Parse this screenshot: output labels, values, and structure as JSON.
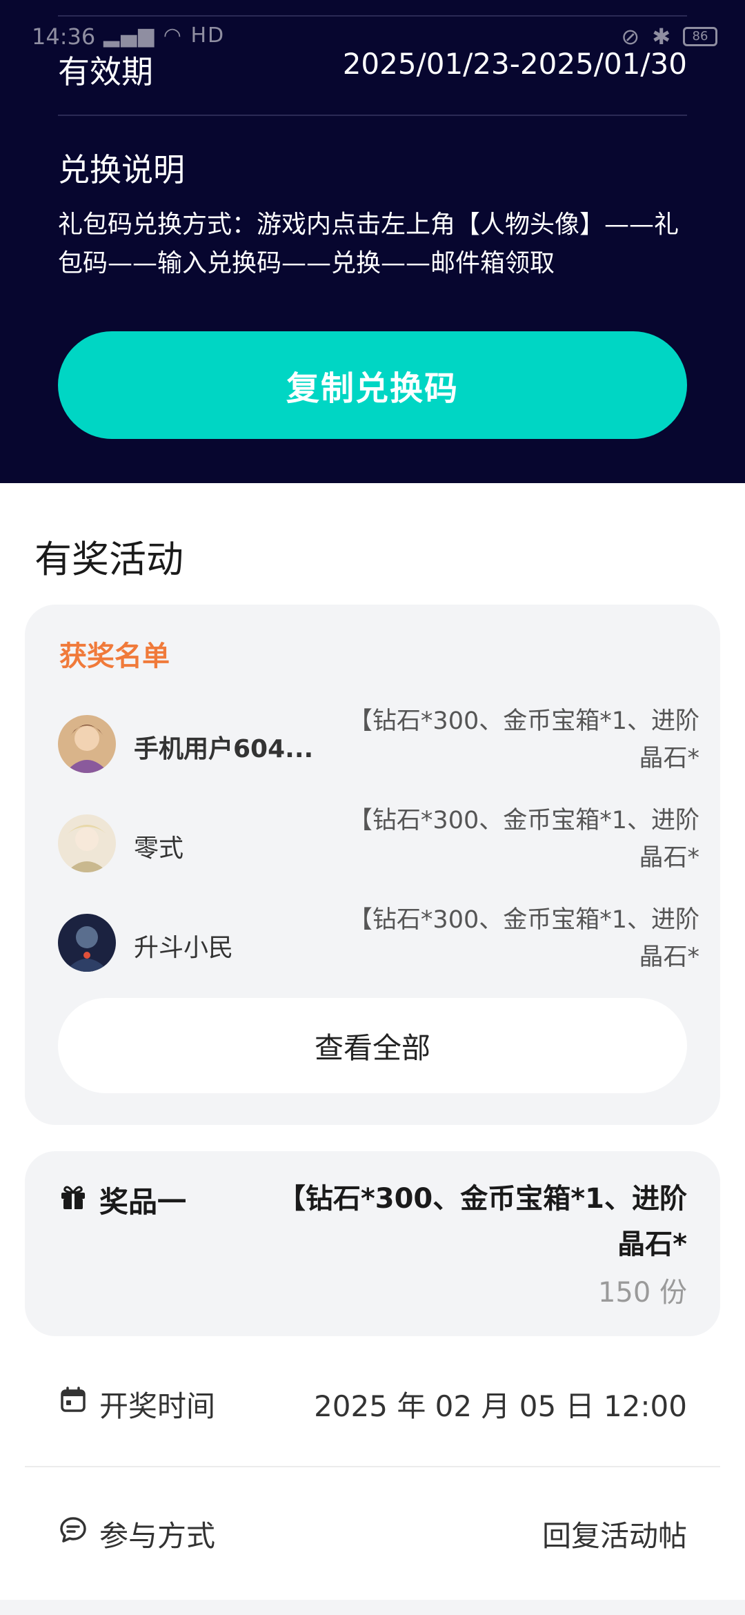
{
  "status_bar": {
    "time": "14:36",
    "network": "HD",
    "battery": "86"
  },
  "code_info": {
    "validity_label": "有效期",
    "validity_value": "2025/01/23-2025/01/30",
    "explain_title": "兑换说明",
    "explain_text": "礼包码兑换方式：游戏内点击左上角【人物头像】——礼包码——输入兑换码——兑换——邮件箱领取",
    "copy_button": "复制兑换码"
  },
  "activity": {
    "section_title": "有奖活动",
    "winners_title": "获奖名单",
    "winners": [
      {
        "name": "手机用户604...",
        "prize": "【钻石*300、金币宝箱*1、进阶晶石*"
      },
      {
        "name": "零式",
        "prize": "【钻石*300、金币宝箱*1、进阶晶石*"
      },
      {
        "name": "升斗小民",
        "prize": "【钻石*300、金币宝箱*1、进阶晶石*"
      }
    ],
    "view_all": "查看全部"
  },
  "prize": {
    "label": "奖品一",
    "description": "【钻石*300、金币宝箱*1、进阶晶石*",
    "count": "150 份"
  },
  "draw": {
    "label": "开奖时间",
    "value": "2025 年 02 月 05 日 12:00"
  },
  "participate": {
    "label": "参与方式",
    "value": "回复活动帖"
  },
  "colors": {
    "dark_bg": "#07062f",
    "accent_button": "#00d6c4",
    "winners_title": "#f07a3a",
    "card_bg": "#f3f4f6"
  }
}
